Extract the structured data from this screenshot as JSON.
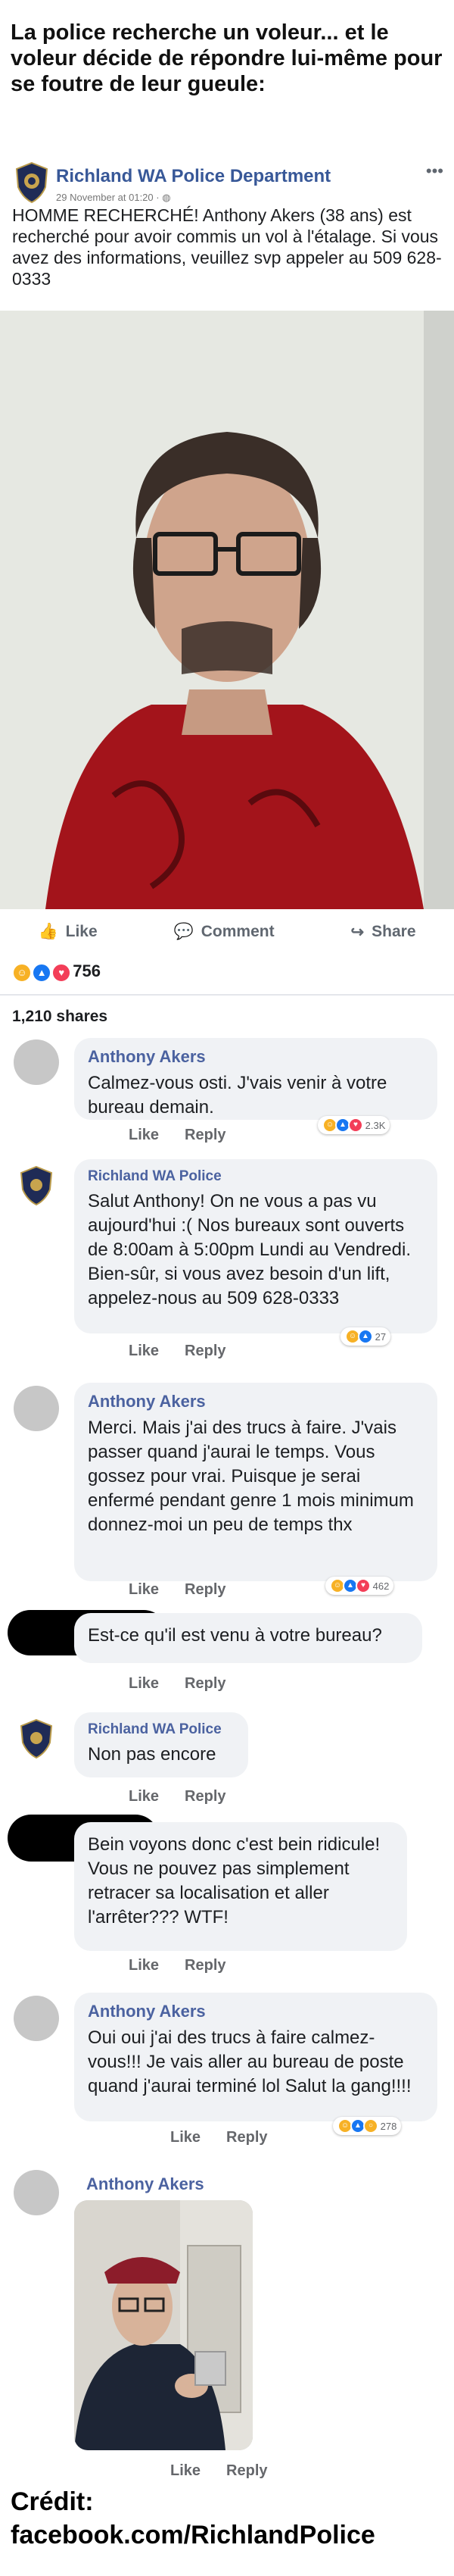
{
  "caption": "La police recherche un voleur... et le voleur décide de répondre lui-même pour se foutre de leur gueule:",
  "post": {
    "page_name": "Richland WA Police Department",
    "meta": "29 November at 01:20 · ",
    "text": "HOMME RECHERCHÉ! Anthony Akers (38 ans) est recherché pour avoir commis un vol à l'étalage. Si vous avez des informations, veuillez svp appeler au 509 628-0333",
    "actions": {
      "like": "Like",
      "comment": "Comment",
      "share": "Share"
    },
    "reaction_count": "756",
    "shares": "1,210 shares"
  },
  "comments": [
    {
      "name": "Anthony Akers",
      "text": "Calmez-vous osti. J'vais venir à votre bureau demain.",
      "like": "Like",
      "reply": "Reply",
      "reactions": "2.3K"
    },
    {
      "name": "Richland WA Police",
      "text": "Salut Anthony! On ne vous a pas vu aujourd'hui :( Nos bureaux sont ouverts de 8:00am à 5:00pm Lundi au Vendredi. Bien-sûr, si vous avez besoin d'un lift, appelez-nous au 509 628-0333",
      "like": "Like",
      "reply": "Reply",
      "reactions": "27"
    },
    {
      "name": "Anthony Akers",
      "text": "Merci. Mais j'ai des trucs à faire. J'vais passer quand j'aurai le temps. Vous gossez pour vrai. Puisque je serai enfermé pendant genre 1 mois minimum donnez-moi un peu de temps thx",
      "like": "Like",
      "reply": "Reply",
      "reactions": "462"
    },
    {
      "name": "",
      "text": "Est-ce qu'il est venu à votre bureau?",
      "like": "Like",
      "reply": "Reply"
    },
    {
      "name": "Richland WA Police",
      "text": "Non pas encore",
      "like": "Like",
      "reply": "Reply"
    },
    {
      "name": "",
      "text": "Bein voyons donc c'est bein ridicule! Vous ne pouvez pas simplement retracer sa localisation et aller l'arrêter??? WTF!",
      "like": "Like",
      "reply": "Reply"
    },
    {
      "name": "Anthony Akers",
      "text": "Oui oui j'ai des trucs à faire calmez-vous!!! Je vais aller au bureau de poste quand j'aurai terminé lol Salut la gang!!!!",
      "like": "Like",
      "reply": "Reply",
      "reactions": "278"
    },
    {
      "name": "Anthony Akers",
      "like": "Like",
      "reply": "Reply"
    }
  ],
  "credit": "Crédit: facebook.com/RichlandPolice"
}
